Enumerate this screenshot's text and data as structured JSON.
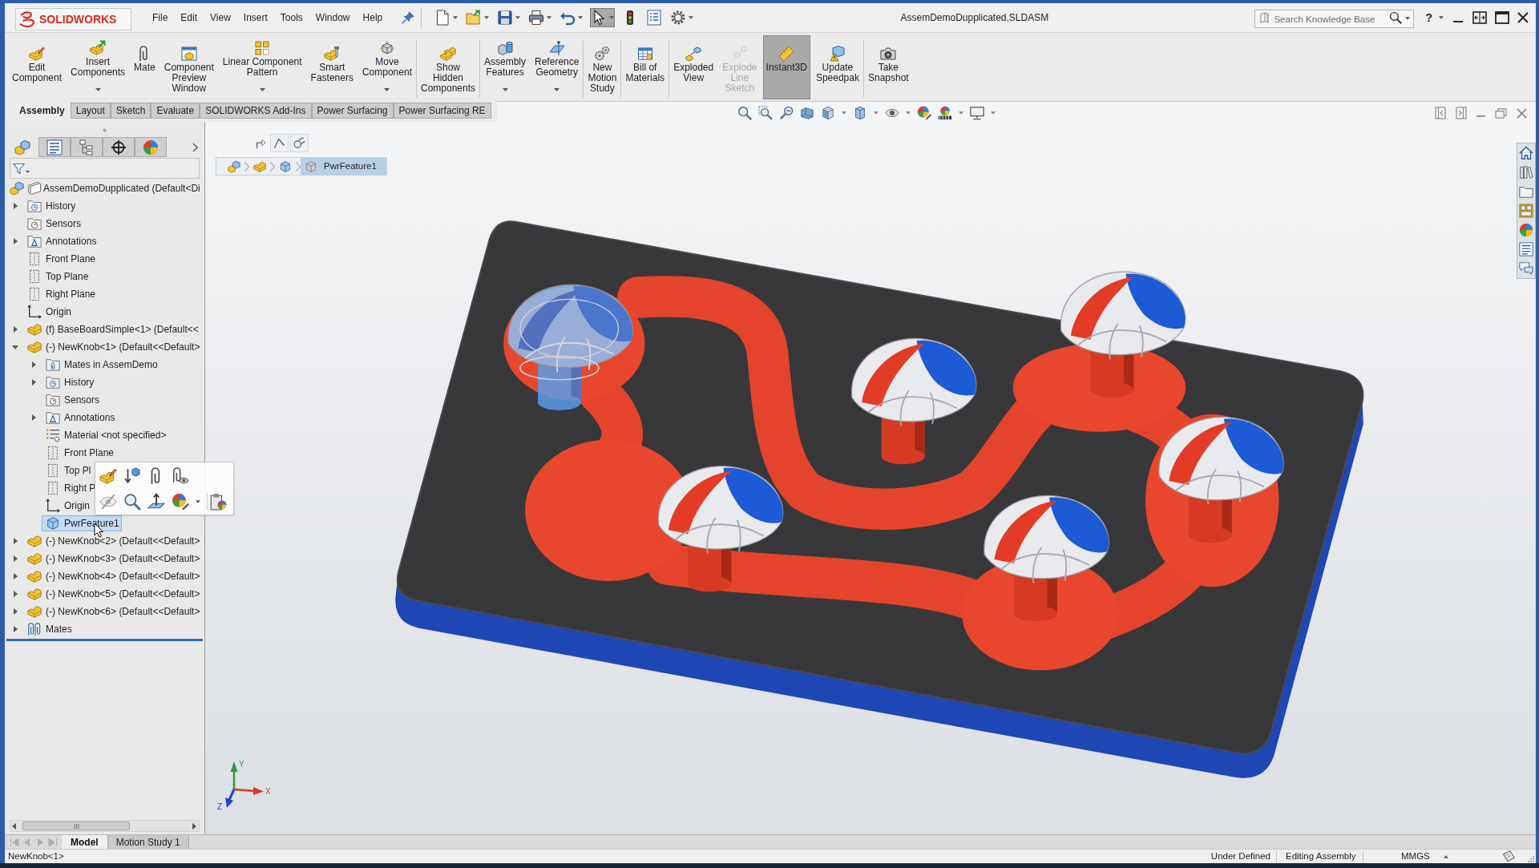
{
  "logo": "SOLIDWORKS",
  "menu": [
    "File",
    "Edit",
    "View",
    "Insert",
    "Tools",
    "Window",
    "Help"
  ],
  "quick_access": [
    {
      "has_menu": true,
      "selected": false
    },
    {
      "has_menu": true,
      "selected": false
    },
    {
      "has_menu": true,
      "selected": false
    },
    {
      "has_menu": true,
      "selected": false
    },
    {
      "has_menu": true,
      "selected": false
    },
    {
      "has_menu": true,
      "selected": true
    },
    {
      "has_menu": false,
      "selected": false
    },
    {
      "has_menu": false,
      "selected": false
    },
    {
      "has_menu": true,
      "selected": false
    }
  ],
  "title": "AssemDemoDupplicated.SLDASM",
  "search": {
    "placeholder": "Search Knowledge Base"
  },
  "help": "?",
  "command_groups": [
    [
      {
        "label": "Edit\nComponent",
        "has_menu": false,
        "selected": false,
        "disabled": false
      },
      {
        "label": "Insert\nComponents",
        "has_menu": true,
        "selected": false,
        "disabled": false
      },
      {
        "label": "Mate",
        "has_menu": false,
        "selected": false,
        "disabled": false
      },
      {
        "label": "Component\nPreview\nWindow",
        "has_menu": false,
        "selected": false,
        "disabled": false
      },
      {
        "label": "Linear Component\nPattern",
        "has_menu": true,
        "selected": false,
        "disabled": false
      },
      {
        "label": "Smart\nFasteners",
        "has_menu": false,
        "selected": false,
        "disabled": false
      },
      {
        "label": "Move\nComponent",
        "has_menu": true,
        "selected": false,
        "disabled": false
      }
    ],
    [
      {
        "label": "Show\nHidden\nComponents",
        "has_menu": false,
        "selected": false,
        "disabled": false
      }
    ],
    [
      {
        "label": "Assembly\nFeatures",
        "has_menu": true,
        "selected": false,
        "disabled": false
      },
      {
        "label": "Reference\nGeometry",
        "has_menu": true,
        "selected": false,
        "disabled": false
      }
    ],
    [
      {
        "label": "New\nMotion\nStudy",
        "has_menu": false,
        "selected": false,
        "disabled": false
      }
    ],
    [
      {
        "label": "Bill of\nMaterials",
        "has_menu": false,
        "selected": false,
        "disabled": false
      }
    ],
    [
      {
        "label": "Exploded\nView",
        "has_menu": false,
        "selected": false,
        "disabled": false
      },
      {
        "label": "Explode\nLine\nSketch",
        "has_menu": false,
        "selected": false,
        "disabled": true
      },
      {
        "label": "Instant3D",
        "has_menu": false,
        "selected": true,
        "disabled": false
      },
      {
        "label": "Update\nSpeedpak",
        "has_menu": false,
        "selected": false,
        "disabled": false
      }
    ],
    [
      {
        "label": "Take\nSnapshot",
        "has_menu": false,
        "selected": false,
        "disabled": false
      }
    ]
  ],
  "command_tabs": [
    {
      "label": "Assembly",
      "selected": true
    },
    {
      "label": "Layout",
      "selected": false
    },
    {
      "label": "Sketch",
      "selected": false
    },
    {
      "label": "Evaluate",
      "selected": false
    },
    {
      "label": "SOLIDWORKS Add-Ins",
      "selected": false
    },
    {
      "label": "Power Surfacing",
      "selected": false
    },
    {
      "label": "Power Surfacing RE",
      "selected": false
    }
  ],
  "panel_tabs": [
    {
      "selected": true
    },
    {
      "selected": false
    },
    {
      "selected": false
    },
    {
      "selected": false
    },
    {
      "selected": false
    }
  ],
  "tree": [
    {
      "label": "AssemDemoDupplicated (Default<Di",
      "kind": "assembly",
      "selected": false,
      "children": [
        {
          "label": "History",
          "kind": "history",
          "expanded": false,
          "selected": false
        },
        {
          "label": "Sensors",
          "kind": "sensors",
          "selected": false
        },
        {
          "label": "Annotations",
          "kind": "annotations",
          "expanded": false,
          "selected": false
        },
        {
          "label": "Front Plane",
          "kind": "plane",
          "selected": false
        },
        {
          "label": "Top Plane",
          "kind": "plane",
          "selected": false
        },
        {
          "label": "Right Plane",
          "kind": "plane",
          "selected": false
        },
        {
          "label": "Origin",
          "kind": "origin",
          "selected": false
        },
        {
          "label": "(f) BaseBoardSimple<1> (Default<<",
          "kind": "component",
          "expanded": false,
          "selected": false
        },
        {
          "label": "(-) NewKnob<1> (Default<<Default>",
          "kind": "component",
          "expanded": true,
          "selected": false,
          "children": [
            {
              "label": "Mates in AssemDemo",
              "kind": "mates-folder",
              "expanded": false,
              "selected": false
            },
            {
              "label": "History",
              "kind": "history",
              "expanded": false,
              "selected": false
            },
            {
              "label": "Sensors",
              "kind": "sensors",
              "selected": false
            },
            {
              "label": "Annotations",
              "kind": "annotations",
              "expanded": false,
              "selected": false
            },
            {
              "label": "Material <not specified>",
              "kind": "material",
              "selected": false
            },
            {
              "label": "Front Plane",
              "kind": "plane",
              "selected": false
            },
            {
              "label": "Top Pl",
              "kind": "plane",
              "selected": false
            },
            {
              "label": "Right P",
              "kind": "plane",
              "selected": false
            },
            {
              "label": "Origin",
              "kind": "origin",
              "selected": false
            },
            {
              "label": "PwrFeature1",
              "kind": "feature",
              "selected": true
            }
          ]
        },
        {
          "label": "(-) NewKnob<2> (Default<<Default>",
          "kind": "component",
          "expanded": false,
          "selected": false
        },
        {
          "label": "(-) NewKnob<3> (Default<<Default>",
          "kind": "component",
          "expanded": false,
          "selected": false
        },
        {
          "label": "(-) NewKnob<4> (Default<<Default>",
          "kind": "component",
          "expanded": false,
          "selected": false
        },
        {
          "label": "(-) NewKnob<5> (Default<<Default>",
          "kind": "component",
          "expanded": false,
          "selected": false
        },
        {
          "label": "(-) NewKnob<6> (Default<<Default>",
          "kind": "component",
          "expanded": false,
          "selected": false
        },
        {
          "label": "Mates",
          "kind": "mates",
          "expanded": false,
          "selected": false
        }
      ]
    }
  ],
  "breadcrumb": [
    {
      "kind": "assembly",
      "selected": false
    },
    {
      "kind": "part",
      "selected": false
    },
    {
      "kind": "body",
      "selected": false
    },
    {
      "kind": "feature",
      "label": "PwrFeature1",
      "selected": true
    }
  ],
  "triad": {
    "x": "X",
    "y": "Y",
    "z": "Z"
  },
  "bottom_tabs": [
    {
      "label": "Model",
      "selected": true
    },
    {
      "label": "Motion Study 1",
      "selected": false
    }
  ],
  "status_bar": {
    "message": "NewKnob<1>",
    "fields": [
      "Under Defined",
      "Editing Assembly",
      "MMGS"
    ]
  }
}
